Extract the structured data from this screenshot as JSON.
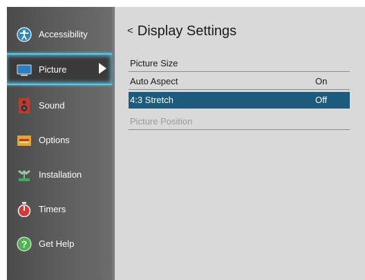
{
  "sidebar": {
    "items": [
      {
        "label": "Accessibility",
        "icon": "accessibility-icon"
      },
      {
        "label": "Picture",
        "icon": "picture-icon",
        "selected": true
      },
      {
        "label": "Sound",
        "icon": "speaker-icon"
      },
      {
        "label": "Options",
        "icon": "options-icon"
      },
      {
        "label": "Installation",
        "icon": "antenna-icon"
      },
      {
        "label": "Timers",
        "icon": "timer-icon"
      },
      {
        "label": "Get Help",
        "icon": "help-icon"
      }
    ]
  },
  "main": {
    "back_glyph": "<",
    "title": "Display Settings",
    "rows": [
      {
        "label": "Picture Size",
        "value": ""
      },
      {
        "label": "Auto Aspect",
        "value": "On"
      },
      {
        "label": "4:3 Stretch",
        "value": "Off",
        "selected": true
      },
      {
        "label": "Picture Position",
        "value": "",
        "disabled": true
      }
    ]
  },
  "colors": {
    "selection_bar": "#1c5a7e",
    "focus_glow": "#5fc6ea",
    "panel_bg": "#d9d9d9"
  }
}
